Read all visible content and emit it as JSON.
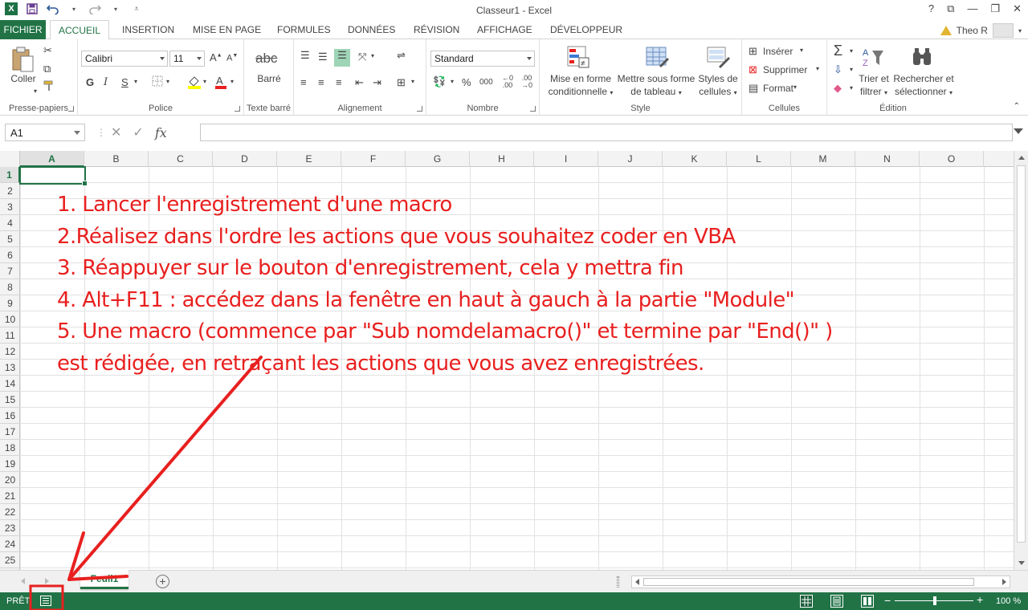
{
  "window": {
    "title": "Classeur1 - Excel",
    "controls": [
      "?",
      "⧉",
      "—",
      "❐",
      "✕"
    ]
  },
  "quick_access": {
    "save_icon": "save-icon",
    "undo_icon": "undo-icon",
    "redo_icon": "redo-icon"
  },
  "tabs": [
    {
      "label": "FICHIER"
    },
    {
      "label": "ACCUEIL"
    },
    {
      "label": "INSERTION"
    },
    {
      "label": "MISE EN PAGE"
    },
    {
      "label": "FORMULES"
    },
    {
      "label": "DONNÉES"
    },
    {
      "label": "RÉVISION"
    },
    {
      "label": "AFFICHAGE"
    },
    {
      "label": "DÉVELOPPEUR"
    }
  ],
  "user": {
    "name": "Theo R"
  },
  "ribbon": {
    "clipboard": {
      "group_label": "Presse-papiers",
      "paste_label": "Coller"
    },
    "font": {
      "group_label": "Police",
      "font_name": "Calibri",
      "font_size": "11",
      "bold": "G",
      "italic": "I",
      "underline": "S"
    },
    "strike": {
      "group_label": "Texte barré",
      "label": "Barré",
      "icon_text": "abc"
    },
    "alignment": {
      "group_label": "Alignement"
    },
    "number": {
      "group_label": "Nombre",
      "format": "Standard",
      "percent": "%",
      "thousands": "000"
    },
    "style": {
      "group_label": "Style",
      "cond_format_line1": "Mise en forme",
      "cond_format_line2": "conditionnelle",
      "table_format_line1": "Mettre sous forme",
      "table_format_line2": "de tableau",
      "cell_styles_line1": "Styles de",
      "cell_styles_line2": "cellules"
    },
    "cells": {
      "group_label": "Cellules",
      "insert": "Insérer",
      "delete": "Supprimer",
      "format": "Format"
    },
    "editing": {
      "group_label": "Édition",
      "sort_line1": "Trier et",
      "sort_line2": "filtrer",
      "find_line1": "Rechercher et",
      "find_line2": "sélectionner"
    }
  },
  "formula_bar": {
    "name_box": "A1",
    "cancel": "✕",
    "enter": "✓",
    "fx": "fx",
    "value": ""
  },
  "grid": {
    "columns": [
      "A",
      "B",
      "C",
      "D",
      "E",
      "F",
      "G",
      "H",
      "I",
      "J",
      "K",
      "L",
      "M",
      "N",
      "O"
    ],
    "rows": [
      "1",
      "2",
      "3",
      "4",
      "5",
      "6",
      "7",
      "8",
      "9",
      "10",
      "11",
      "12",
      "13",
      "14",
      "15",
      "16",
      "17",
      "18",
      "19",
      "20",
      "21",
      "22",
      "23",
      "24",
      "25"
    ],
    "active_cell": "A1"
  },
  "annotation": {
    "color": "#e8201f",
    "lines": [
      "1. Lancer l'enregistrement d'une macro",
      "2.Réalisez dans l'ordre les actions que vous souhaitez coder en VBA",
      "3. Réappuyer sur le bouton d'enregistrement, cela y mettra fin",
      "4. Alt+F11 : accédez dans la fenêtre en haut à gauch à la partie \"Module\"",
      "5. Une macro (commence par \"Sub nomdelamacro()\" et termine par \"End()\" )",
      "est rédigée, en retraçant les actions que vous avez enregistrées."
    ]
  },
  "sheets": [
    {
      "label": "Feuil1"
    }
  ],
  "add_sheet": "+",
  "status": {
    "ready": "PRÊT",
    "zoom_level": "100 %",
    "zoom_minus": "−",
    "zoom_plus": "+",
    "zoom_fraction": 0.5
  },
  "colors": {
    "accent": "#217346",
    "annotation": "#e8201f"
  }
}
